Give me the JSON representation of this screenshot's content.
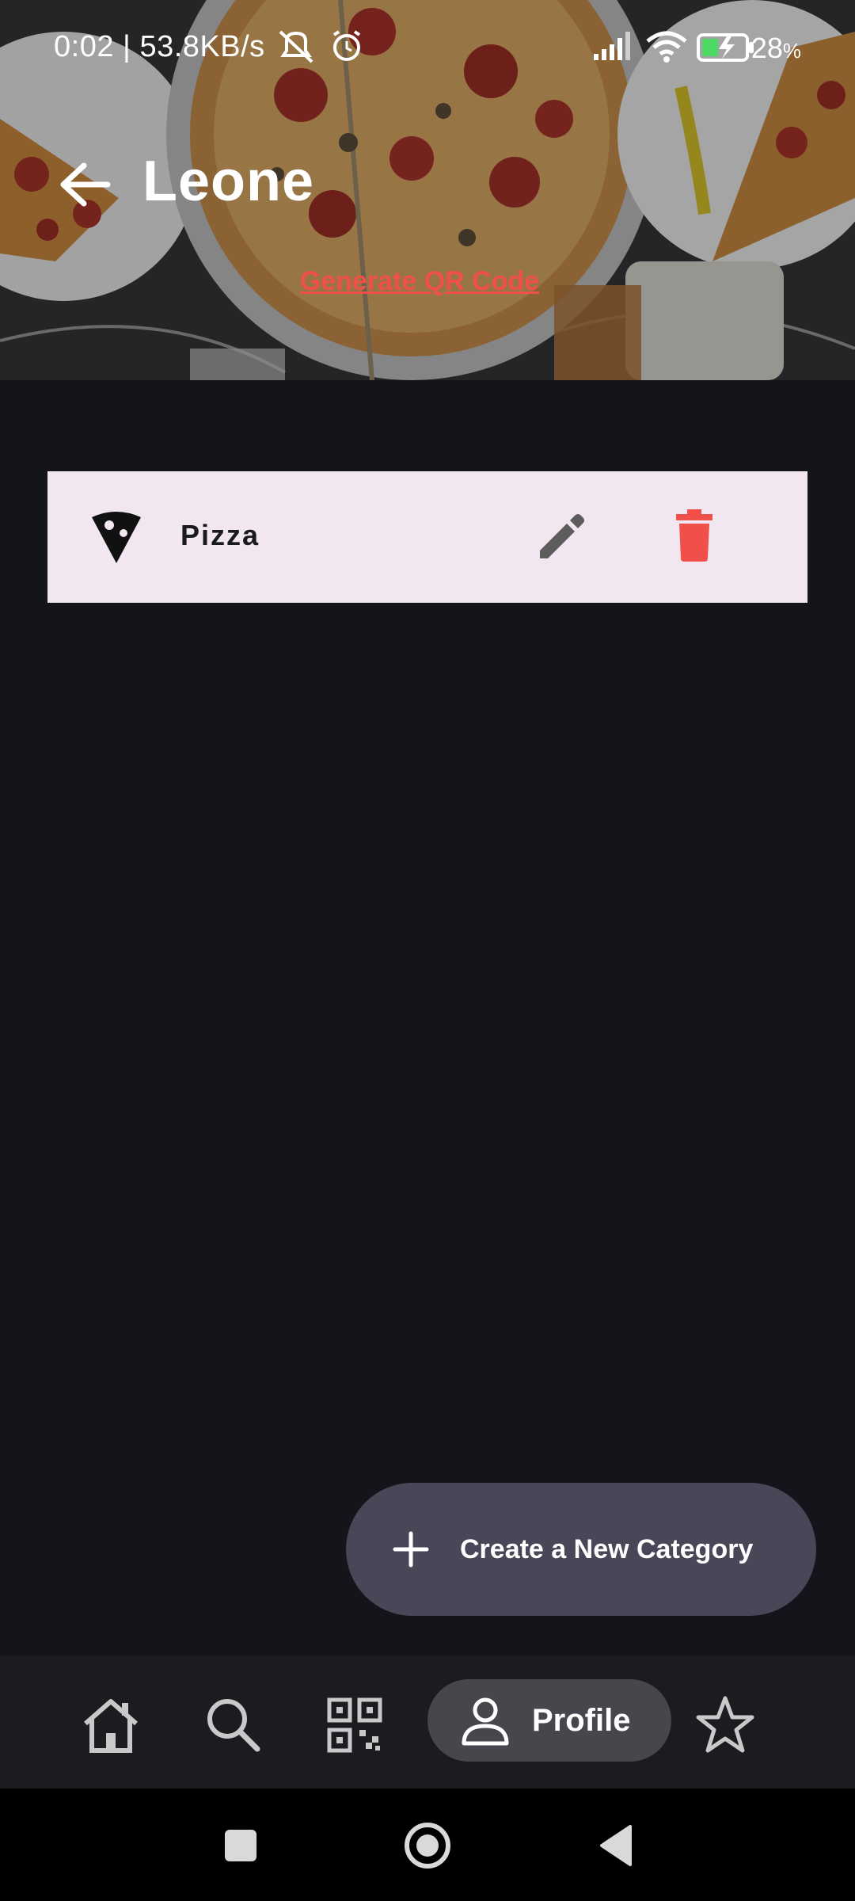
{
  "status_bar": {
    "time_and_speed": "0:02 | 53.8KB/s",
    "battery_percent": "28",
    "battery_unit": "%"
  },
  "header": {
    "title": "Leone",
    "qr_link": "Generate QR Code"
  },
  "categories": [
    {
      "name": "Pizza",
      "icon": "pizza-slice-icon"
    }
  ],
  "fab": {
    "label": "Create a New Category",
    "icon": "plus-icon"
  },
  "bottom_nav": {
    "items": [
      {
        "icon": "home-icon"
      },
      {
        "icon": "search-icon"
      },
      {
        "icon": "qr-code-icon"
      },
      {
        "icon": "person-icon",
        "label": "Profile",
        "active": true
      },
      {
        "icon": "star-icon"
      }
    ]
  },
  "colors": {
    "background": "#13151a",
    "accent_red": "#f04f4a",
    "category_row": "#f2e6f1",
    "fab": "#4b4558",
    "nav_bar": "#1c1c20",
    "nav_active_pill": "#48464c"
  }
}
